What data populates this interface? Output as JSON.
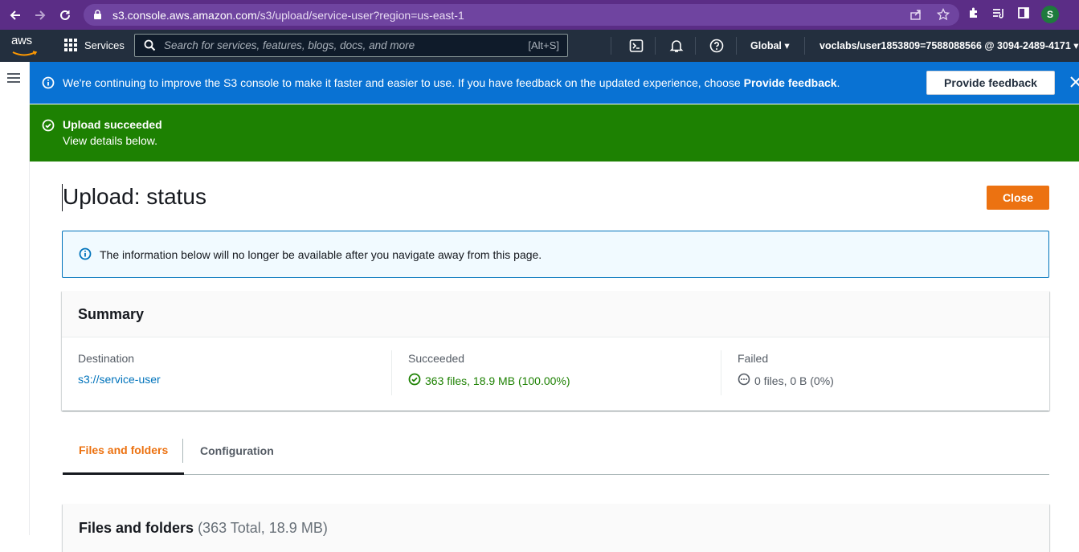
{
  "browser": {
    "url_host": "s3.console.aws.amazon.com",
    "url_path": "/s3/upload/service-user?region=us-east-1",
    "profile_initial": "S"
  },
  "aws_nav": {
    "logo_text": "aws",
    "services_label": "Services",
    "search_placeholder": "Search for services, features, blogs, docs, and more",
    "search_shortcut": "[Alt+S]",
    "region_label": "Global",
    "account_label": "voclabs/user1853809=7588088566 @ 3094-2489-4171"
  },
  "info_flash": {
    "message_prefix": "We're continuing to improve the S3 console to make it faster and easier to use. If you have feedback on the updated experience, choose ",
    "message_bold": "Provide feedback",
    "message_suffix": ".",
    "button_label": "Provide feedback"
  },
  "success_flash": {
    "title": "Upload succeeded",
    "subtitle": "View details below."
  },
  "page": {
    "title": "Upload: status",
    "close_label": "Close",
    "alert_text": "The information below will no longer be available after you navigate away from this page."
  },
  "summary": {
    "heading": "Summary",
    "destination_label": "Destination",
    "destination_value": "s3://service-user",
    "succeeded_label": "Succeeded",
    "succeeded_value": "363 files, 18.9 MB (100.00%)",
    "failed_label": "Failed",
    "failed_value": "0 files, 0 B (0%)"
  },
  "tabs": [
    {
      "label": "Files and folders",
      "active": true
    },
    {
      "label": "Configuration",
      "active": false
    }
  ],
  "files_section": {
    "heading": "Files and folders",
    "count_text": "(363 Total, 18.9 MB)"
  },
  "colors": {
    "chrome_purple": "#5b2d86",
    "aws_navy": "#232f3e",
    "info_blue": "#0972d3",
    "success_green": "#1d8102",
    "accent_orange": "#ec7211"
  }
}
